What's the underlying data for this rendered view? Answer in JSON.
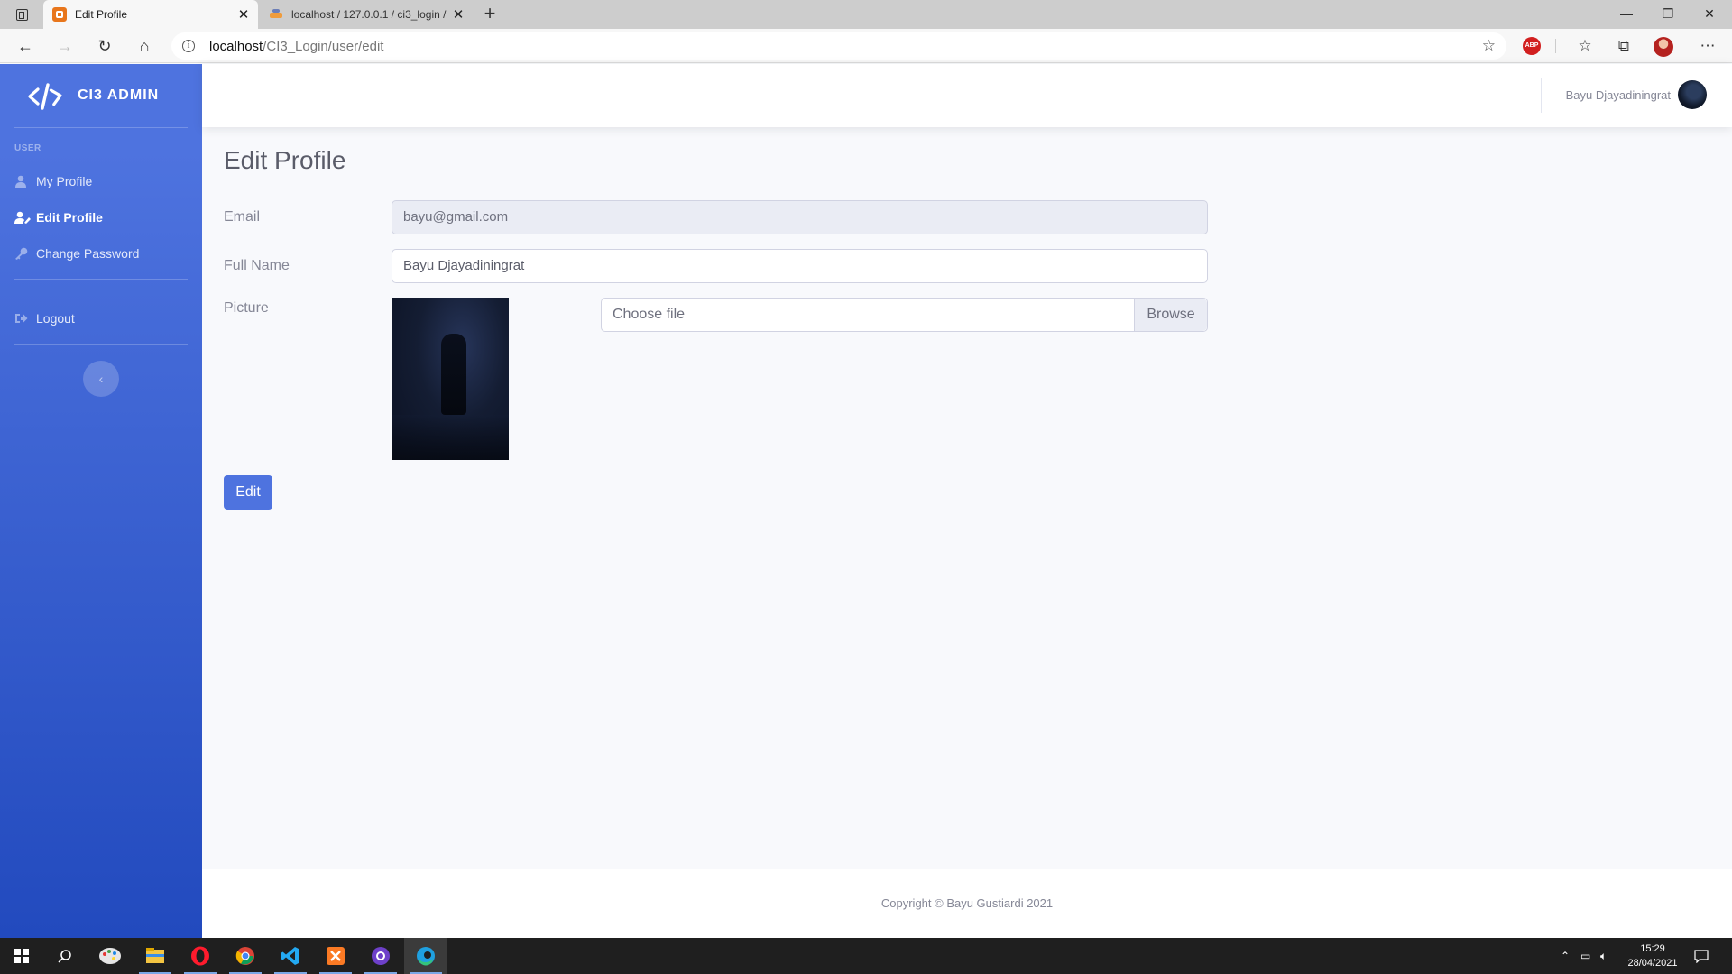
{
  "browser": {
    "tabs": [
      {
        "title": "Edit Profile",
        "active": true
      },
      {
        "title": "localhost / 127.0.0.1 / ci3_login /",
        "active": false
      }
    ],
    "url_host": "localhost",
    "url_path": "/CI3_Login/user/edit"
  },
  "sidebar": {
    "brand": "CI3 ADMIN",
    "heading": "USER",
    "items": [
      {
        "label": "My Profile",
        "icon": "user-icon",
        "active": false
      },
      {
        "label": "Edit Profile",
        "icon": "user-edit-icon",
        "active": true
      },
      {
        "label": "Change Password",
        "icon": "key-icon",
        "active": false
      }
    ],
    "logout": {
      "label": "Logout",
      "icon": "sign-out-icon"
    }
  },
  "topbar": {
    "user_name": "Bayu Djayadiningrat"
  },
  "page": {
    "title": "Edit Profile",
    "form": {
      "email_label": "Email",
      "email_value": "bayu@gmail.com",
      "fullname_label": "Full Name",
      "fullname_value": "Bayu Djayadiningrat",
      "picture_label": "Picture",
      "file_placeholder": "Choose file",
      "browse_label": "Browse",
      "submit_label": "Edit"
    }
  },
  "footer": {
    "copyright": "Copyright © Bayu Gustiardi 2021"
  },
  "taskbar": {
    "time": "15:29",
    "date": "28/04/2021"
  },
  "colors": {
    "primary": "#4e73df",
    "sidebar_gradient_end": "#224abe",
    "page_background": "#f8f9fc",
    "text_muted": "#858796"
  }
}
